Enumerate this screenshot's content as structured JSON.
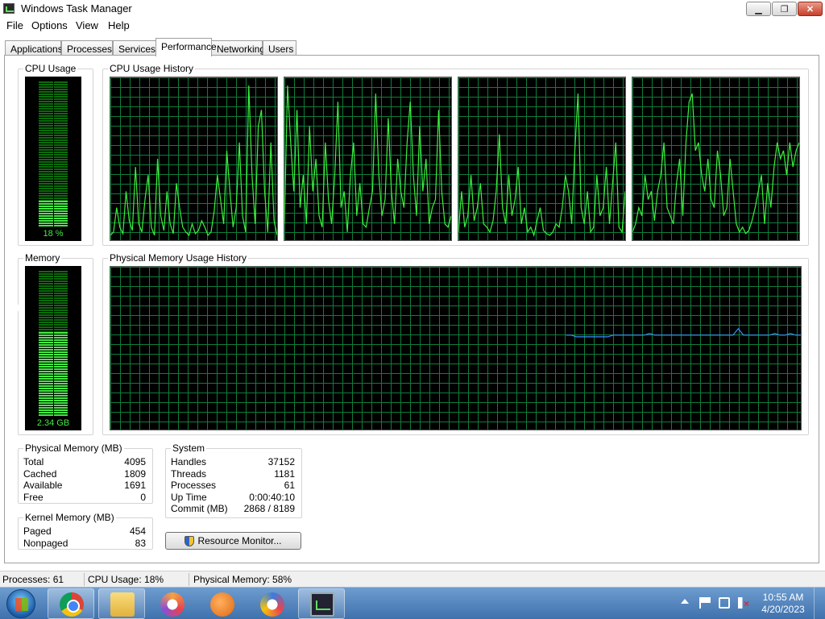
{
  "window": {
    "title": "Windows Task Manager",
    "buttons": {
      "minimize": "▁",
      "maximize": "❐",
      "close": "✕"
    }
  },
  "menu": [
    "File",
    "Options",
    "View",
    "Help"
  ],
  "tabs": [
    {
      "label": "Applications",
      "active": false
    },
    {
      "label": "Processes",
      "active": false
    },
    {
      "label": "Services",
      "active": false
    },
    {
      "label": "Performance",
      "active": true
    },
    {
      "label": "Networking",
      "active": false
    },
    {
      "label": "Users",
      "active": false
    }
  ],
  "performance": {
    "cpu_usage": {
      "title": "CPU Usage",
      "label": "18 %",
      "fraction": 0.18
    },
    "cpu_history": {
      "title": "CPU Usage History"
    },
    "memory": {
      "title": "Memory",
      "label": "2.34 GB",
      "fraction": 0.58
    },
    "memory_history": {
      "title": "Physical Memory Usage History"
    },
    "physical_memory": {
      "title": "Physical Memory (MB)",
      "rows": [
        {
          "label": "Total",
          "value": "4095"
        },
        {
          "label": "Cached",
          "value": "1809"
        },
        {
          "label": "Available",
          "value": "1691"
        },
        {
          "label": "Free",
          "value": "0"
        }
      ]
    },
    "kernel_memory": {
      "title": "Kernel Memory (MB)",
      "rows": [
        {
          "label": "Paged",
          "value": "454"
        },
        {
          "label": "Nonpaged",
          "value": "83"
        }
      ]
    },
    "system": {
      "title": "System",
      "rows": [
        {
          "label": "Handles",
          "value": "37152"
        },
        {
          "label": "Threads",
          "value": "1181"
        },
        {
          "label": "Processes",
          "value": "61"
        },
        {
          "label": "Up Time",
          "value": "0:00:40:10"
        },
        {
          "label": "Commit (MB)",
          "value": "2868 / 8189"
        }
      ]
    },
    "resource_monitor_button": "Resource Monitor..."
  },
  "statusbar": {
    "processes": "Processes: 61",
    "cpu": "CPU Usage: 18%",
    "memory": "Physical Memory: 58%"
  },
  "taskbar": {
    "apps": [
      "chrome-icon",
      "folder-icon",
      "ring-icon",
      "orange-icon",
      "ring2-icon",
      "task-manager-icon"
    ],
    "clock": {
      "time": "10:55 AM",
      "date": "4/20/2023"
    }
  },
  "colors": {
    "graph_line": "#3cf03c",
    "memory_line": "#3b8fff",
    "grid": "#0f7d3a",
    "meter": "#45e845"
  },
  "chart_data": [
    {
      "type": "line",
      "title": "CPU Usage History",
      "ylim": [
        0,
        100
      ],
      "series": [
        {
          "values": [
            3,
            5,
            20,
            8,
            4,
            30,
            12,
            6,
            45,
            10,
            5,
            25,
            40,
            8,
            3,
            50,
            15,
            6,
            30,
            10,
            4,
            35,
            20,
            8,
            5,
            3,
            10,
            4,
            6,
            12,
            8,
            3,
            5,
            18,
            40,
            25,
            10,
            55,
            30,
            8,
            20,
            60,
            15,
            5,
            95,
            40,
            10,
            70,
            80,
            30,
            5,
            60,
            12,
            3
          ]
        },
        {
          "values": [
            10,
            95,
            60,
            30,
            80,
            20,
            40,
            10,
            70,
            30,
            50,
            15,
            8,
            60,
            25,
            10,
            40,
            85,
            20,
            30,
            5,
            40,
            60,
            15,
            35,
            10,
            8,
            20,
            30,
            90,
            40,
            15,
            25,
            75,
            30,
            10,
            50,
            30,
            20,
            60,
            85,
            40,
            15,
            70,
            30,
            50,
            10,
            20,
            25,
            80,
            30,
            10,
            8,
            15
          ]
        },
        {
          "values": [
            5,
            30,
            8,
            15,
            40,
            12,
            20,
            35,
            10,
            8,
            5,
            12,
            30,
            65,
            20,
            10,
            40,
            15,
            25,
            45,
            10,
            20,
            5,
            8,
            3,
            12,
            20,
            6,
            4,
            3,
            5,
            10,
            8,
            20,
            40,
            30,
            10,
            55,
            90,
            20,
            10,
            30,
            5,
            8,
            40,
            15,
            20,
            45,
            10,
            35,
            60,
            8,
            5,
            30
          ]
        },
        {
          "values": [
            5,
            10,
            20,
            15,
            40,
            25,
            30,
            12,
            30,
            40,
            60,
            20,
            15,
            10,
            35,
            50,
            15,
            60,
            85,
            90,
            55,
            60,
            40,
            30,
            50,
            25,
            20,
            55,
            40,
            15,
            20,
            50,
            30,
            10,
            5,
            8,
            4,
            6,
            12,
            20,
            30,
            40,
            10,
            35,
            20,
            45,
            60,
            50,
            55,
            40,
            60,
            45,
            55,
            60
          ]
        }
      ]
    },
    {
      "type": "line",
      "title": "Physical Memory Usage History",
      "ylim": [
        0,
        100
      ],
      "series": [
        {
          "values": [
            58,
            58,
            57,
            57,
            57,
            57,
            57,
            57,
            57,
            58,
            58,
            58,
            58,
            58,
            58,
            58,
            59,
            58,
            58,
            58,
            58,
            58,
            58,
            58,
            58,
            58,
            58,
            58,
            58,
            58,
            58,
            58,
            58,
            62,
            58,
            58,
            58,
            58,
            58,
            58,
            59,
            58,
            58,
            59,
            58,
            58
          ]
        }
      ]
    }
  ]
}
